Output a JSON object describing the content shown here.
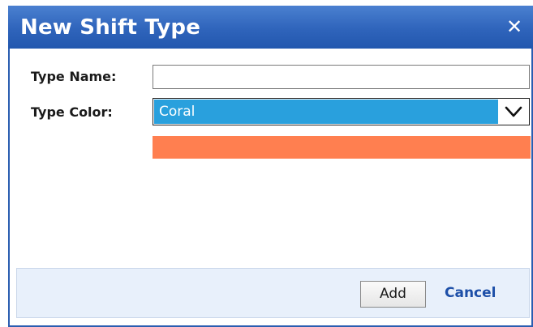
{
  "dialog": {
    "title": "New Shift Type",
    "close_glyph": "✕"
  },
  "form": {
    "type_name_label": "Type Name:",
    "type_name_value": "",
    "type_color_label": "Type Color:",
    "type_color_selected": "Coral",
    "swatch_color": "#ff7f50"
  },
  "footer": {
    "add_label": "Add",
    "cancel_label": "Cancel"
  },
  "colors": {
    "titlebar": "#2f64bb",
    "select_highlight": "#29a0dd",
    "link": "#1d4fa8"
  }
}
